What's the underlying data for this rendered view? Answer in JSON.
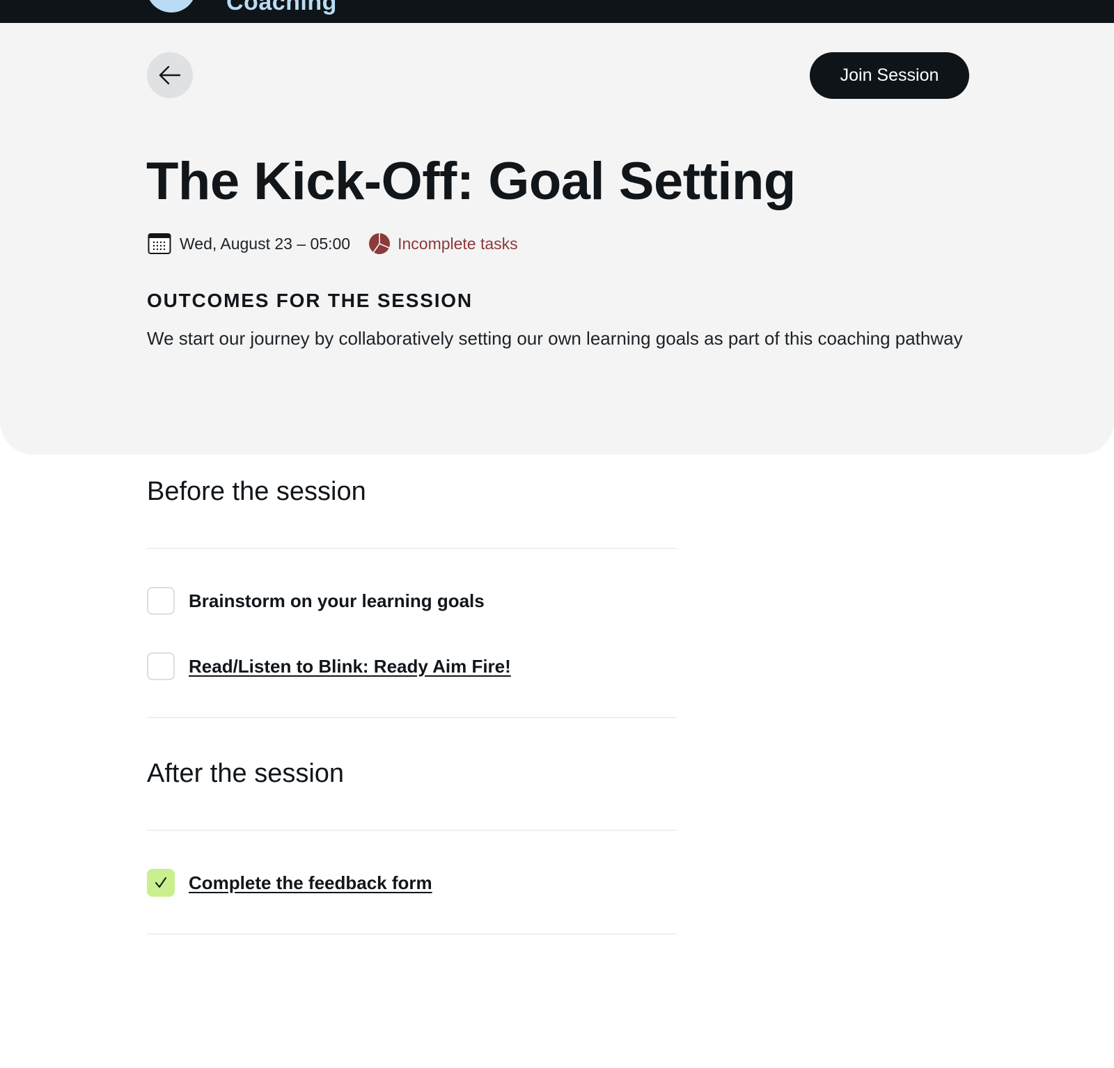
{
  "topbar": {
    "brand": "Coaching",
    "logo_icon": "logo-mark",
    "background": "#0f1419",
    "brand_color": "#b9dcf4"
  },
  "header": {
    "back_icon": "arrow-left-icon",
    "join_label": "Join Session",
    "title": "The Kick-Off: Goal Setting",
    "date_icon": "calendar-icon",
    "date": "Wed, August 23 – 05:00",
    "status_icon": "pie-chart-icon",
    "status": "Incomplete tasks",
    "status_color": "#8c3a3a",
    "outcomes_heading": "OUTCOMES FOR THE SESSION",
    "outcomes_text": "We start our journey by collaboratively setting our own learning goals as part of this coaching pathway"
  },
  "before": {
    "heading": "Before the session",
    "tasks": [
      {
        "label": "Brainstorm on your learning goals",
        "checked": false,
        "link": false
      },
      {
        "label": "Read/Listen to Blink: Ready Aim Fire!",
        "checked": false,
        "link": true
      }
    ]
  },
  "after": {
    "heading": "After the session",
    "tasks": [
      {
        "label": "Complete the feedback form",
        "checked": true,
        "link": true
      }
    ]
  },
  "colors": {
    "panel": "#f4f4f4",
    "checked": "#c9ef8e",
    "dark": "#0f1419"
  }
}
